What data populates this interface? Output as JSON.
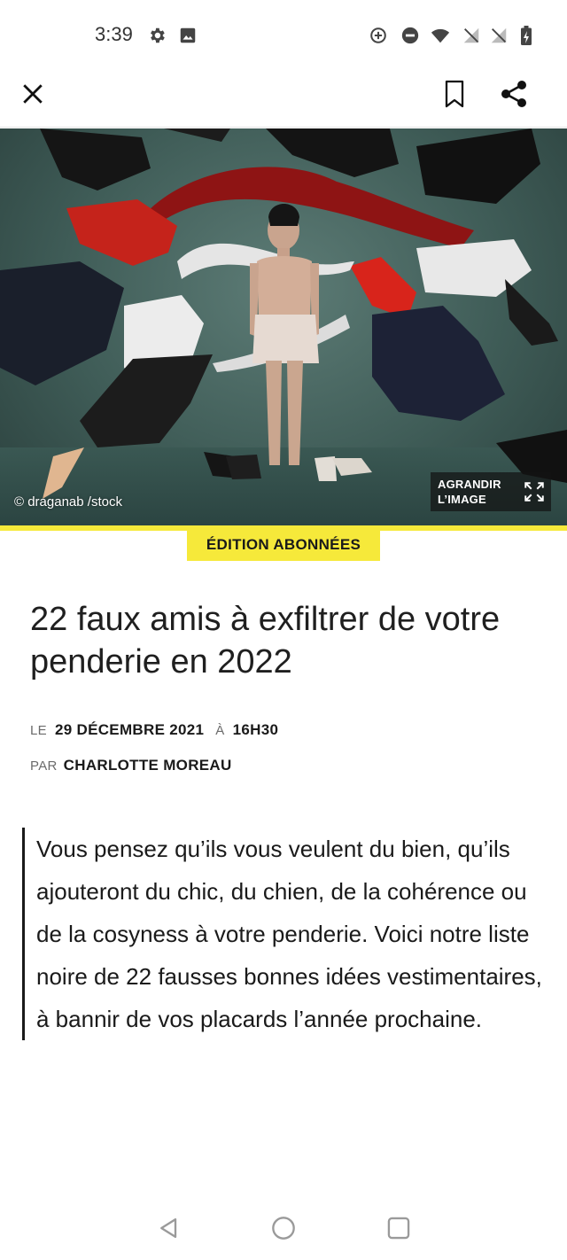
{
  "status_bar": {
    "time": "3:39",
    "icons": [
      "gear-icon",
      "image-icon",
      "data-saver-icon",
      "do-not-disturb-icon",
      "wifi-icon",
      "signal-off-icon",
      "signal-off-icon",
      "battery-charging-icon"
    ]
  },
  "app_bar": {
    "close_icon": "close-icon",
    "bookmark_icon": "bookmark-icon",
    "share_icon": "share-icon"
  },
  "hero": {
    "credit": "© draganab /stock",
    "enlarge_line1": "AGRANDIR",
    "enlarge_line2": "L’IMAGE",
    "enlarge_icon": "expand-icon"
  },
  "article": {
    "badge": "ÉDITION ABONNÉES",
    "headline": "22 faux amis à exfiltrer de votre penderie en 2022",
    "date_prefix": "LE",
    "date": "29 DÉCEMBRE 2021",
    "time_prefix": "À",
    "time": "16H30",
    "author_prefix": "PAR",
    "author": "CHARLOTTE MOREAU",
    "lede": "Vous pensez qu’ils vous veulent du bien, qu’ils ajouteront du chic, du chien, de la cohérence ou de la cosyness à votre penderie. Voici notre liste noire de 22 fausses bonnes idées vestimentaires, à bannir de vos placards l’année prochaine."
  },
  "colors": {
    "accent_yellow": "#f6e93a",
    "text": "#1a1a1a",
    "hero_background": "#4a6862"
  },
  "nav_bar": {
    "icons": [
      "back-triangle-icon",
      "home-circle-icon",
      "recents-square-icon"
    ]
  }
}
